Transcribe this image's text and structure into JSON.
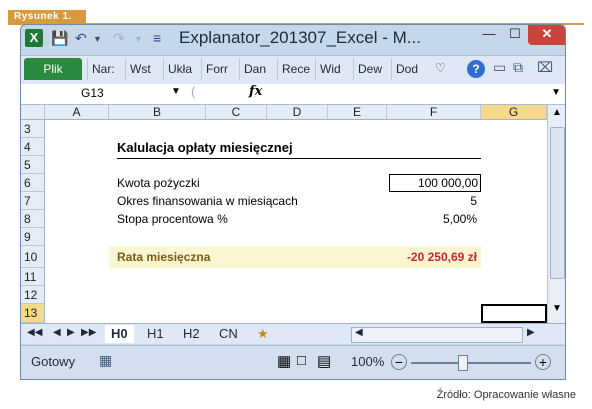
{
  "figure": {
    "label": "Rysunek 1.",
    "source": "Źródło: Opracowanie własne"
  },
  "window": {
    "title": "Explanator_201307_Excel  -  M...",
    "icons": [
      "excel-app-icon",
      "save-icon",
      "undo-icon",
      "redo-icon",
      "customize-qa-icon"
    ],
    "controls": {
      "minimize": "—",
      "maximize": "☐",
      "close": "✕"
    }
  },
  "ribbon": {
    "file_tab": "Plik",
    "tabs": [
      "Nar:",
      "Wst",
      "Ukła",
      "Forr",
      "Dan",
      "Rece",
      "Wid",
      "Dew",
      "Dod"
    ],
    "help": "?"
  },
  "formula_bar": {
    "name_box": "G13",
    "fx": "fx",
    "formula": ""
  },
  "columns": [
    "A",
    "B",
    "C",
    "D",
    "E",
    "F",
    "G"
  ],
  "selected_column": "G",
  "rows": [
    "3",
    "4",
    "5",
    "6",
    "7",
    "8",
    "9",
    "10",
    "11",
    "12",
    "13"
  ],
  "selected_row": "13",
  "sheet": {
    "title": "Kalulacja opłaty miesięcznej",
    "loan_label": "Kwota pożyczki",
    "loan_value": "100 000,00",
    "term_label": "Okres finansowania w miesiącach",
    "term_value": "5",
    "rate_label": "Stopa procentowa %",
    "rate_value": "5,00%",
    "payment_label": "Rata miesięczna",
    "payment_value": "-20 250,69 zł"
  },
  "sheet_tabs": [
    "H0",
    "H1",
    "H2",
    "CN"
  ],
  "active_sheet": "H0",
  "status": {
    "ready": "Gotowy",
    "zoom": "100%"
  },
  "colors": {
    "accent": "#d89a3a",
    "negative": "#c0282d",
    "highlight": "#fbf6d2",
    "file_tab": "#2a8a3e"
  }
}
